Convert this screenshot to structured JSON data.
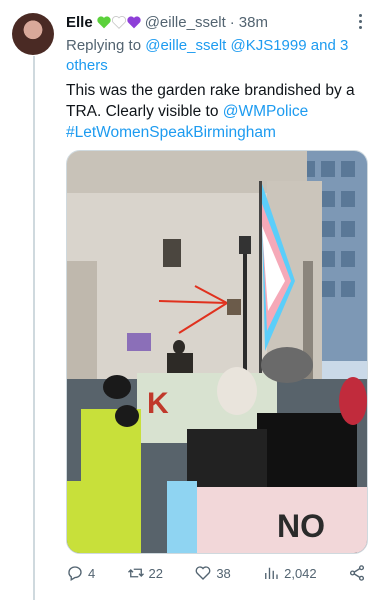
{
  "tweet": {
    "name": "Elle",
    "handle": "@eille_sselt",
    "separator": "·",
    "time": "38m",
    "replying_prefix": "Replying to",
    "replying_to": "@eille_sselt @KJS1999 and 3 others",
    "body_text": "This was the garden rake brandished by a TRA. Clearly visible to",
    "body_mention": "@WMPolice",
    "body_hashtag": "#LetWomenSpeakBirmingham",
    "emoji_colors": [
      "#5bd13b",
      "#ffffff",
      "#8e3fd8"
    ]
  },
  "actions": {
    "replies": "4",
    "retweets": "22",
    "likes": "38",
    "views": "2,042"
  },
  "media": {
    "banner_text": "NO",
    "sign_text": "K"
  }
}
